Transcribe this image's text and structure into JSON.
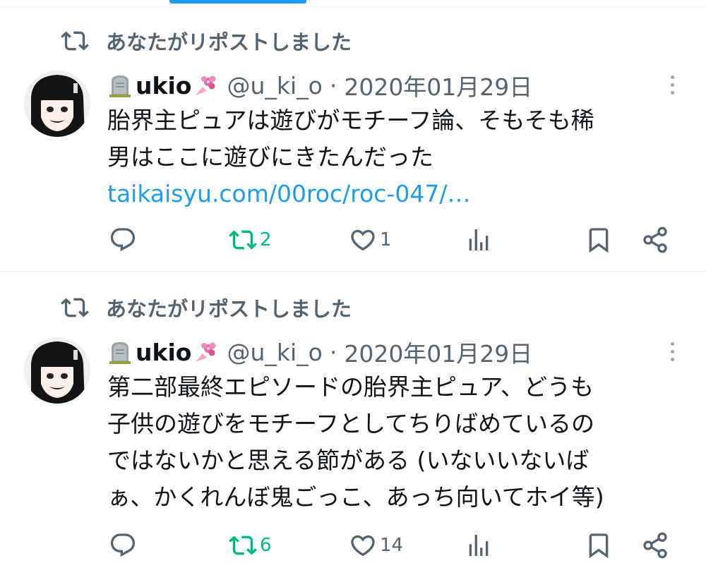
{
  "tweets": [
    {
      "repost_label": "あなたがリポストしました",
      "name": "ukio",
      "handle": "@u_ki_o",
      "separator": "·",
      "date": "2020年01月29日",
      "lines": [
        "胎界主ピュアは遊びがモチーフ論、そもそも稀",
        "男はここに遊びにきたんだった"
      ],
      "link": "taikaisyu.com/00roc/roc-047/…",
      "reply_count": "",
      "retweet_count": "2",
      "like_count": "1"
    },
    {
      "repost_label": "あなたがリポストしました",
      "name": "ukio",
      "handle": "@u_ki_o",
      "separator": "·",
      "date": "2020年01月29日",
      "lines": [
        "第二部最終エピソードの胎界主ピュア、どうも",
        "子供の遊びをモチーフとしてちりばめているの",
        "ではないかと思える節がある (いないいないば",
        "ぁ、かくれんぼ鬼ごっこ、あっち向いてホイ等)"
      ],
      "link": "",
      "reply_count": "",
      "retweet_count": "6",
      "like_count": "14"
    }
  ],
  "colors": {
    "accent": "#1d9bf0",
    "secondary_text": "#536471",
    "retweeted_green": "#00ba7c",
    "divider": "#eff3f4"
  },
  "icons": {
    "repost": "repost-icon",
    "gravestone": "headstone-emoji-icon",
    "flower": "bouquet-emoji-icon",
    "reply": "reply-icon",
    "retweet": "retweet-icon",
    "like": "heart-icon",
    "views": "views-icon",
    "bookmark": "bookmark-icon",
    "share": "share-icon",
    "more": "more-options-icon"
  }
}
